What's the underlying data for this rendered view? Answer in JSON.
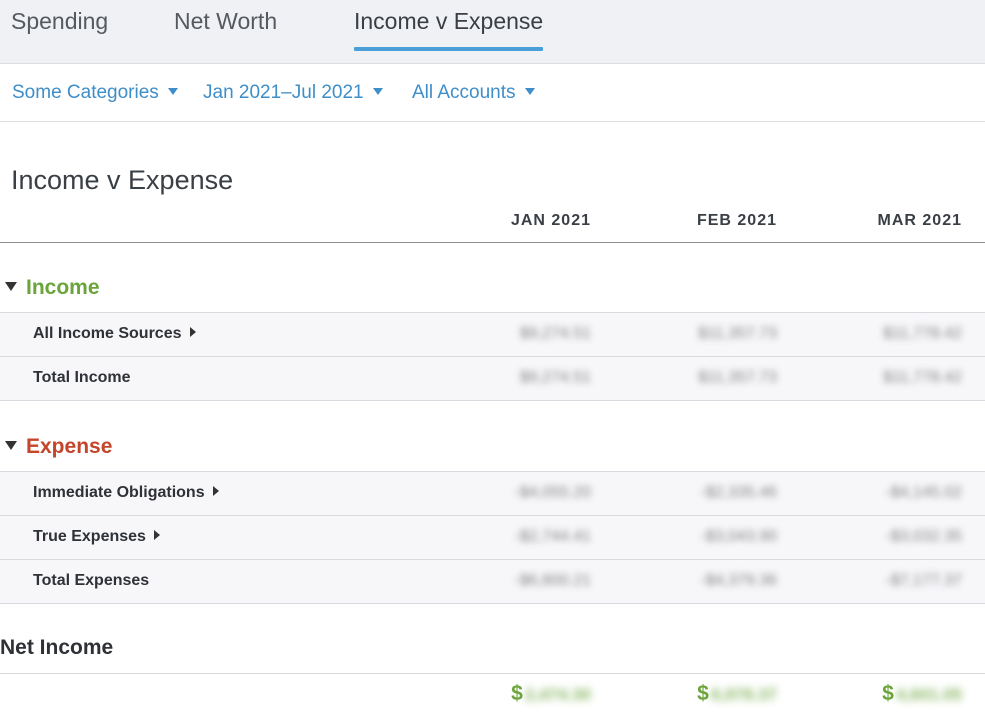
{
  "tabs": [
    {
      "label": "Spending"
    },
    {
      "label": "Net Worth"
    },
    {
      "label": "Income v Expense"
    }
  ],
  "filters": {
    "categories": "Some Categories",
    "date_range": "Jan 2021–Jul 2021",
    "accounts": "All Accounts"
  },
  "report": {
    "title": "Income v Expense",
    "columns": [
      "JAN 2021",
      "FEB 2021",
      "MAR 2021"
    ]
  },
  "income": {
    "heading": "Income",
    "rows": [
      {
        "label": "All Income Sources",
        "values": [
          "$9,274.51",
          "$11,357.73",
          "$11,778.42"
        ]
      },
      {
        "label": "Total Income",
        "values": [
          "$9,274.51",
          "$11,357.73",
          "$11,778.42"
        ]
      }
    ]
  },
  "expense": {
    "heading": "Expense",
    "rows": [
      {
        "label": "Immediate Obligations",
        "values": [
          "-$4,055.20",
          "-$2,335.46",
          "-$4,145.02"
        ]
      },
      {
        "label": "True Expenses",
        "values": [
          "-$2,744.41",
          "-$3,043.90",
          "-$3,032.35"
        ]
      },
      {
        "label": "Total Expenses",
        "values": [
          "-$6,800.21",
          "-$4,379.36",
          "-$7,177.37"
        ]
      }
    ]
  },
  "net_income": {
    "heading": "Net Income",
    "currency_symbol": "$",
    "values": [
      "2,474.30",
      "6,978.37",
      "4,601.05"
    ]
  },
  "colors": {
    "accent": "#4a9fd8",
    "link": "#3e8ec9",
    "income": "#6aa43a",
    "expense": "#c4452a"
  }
}
